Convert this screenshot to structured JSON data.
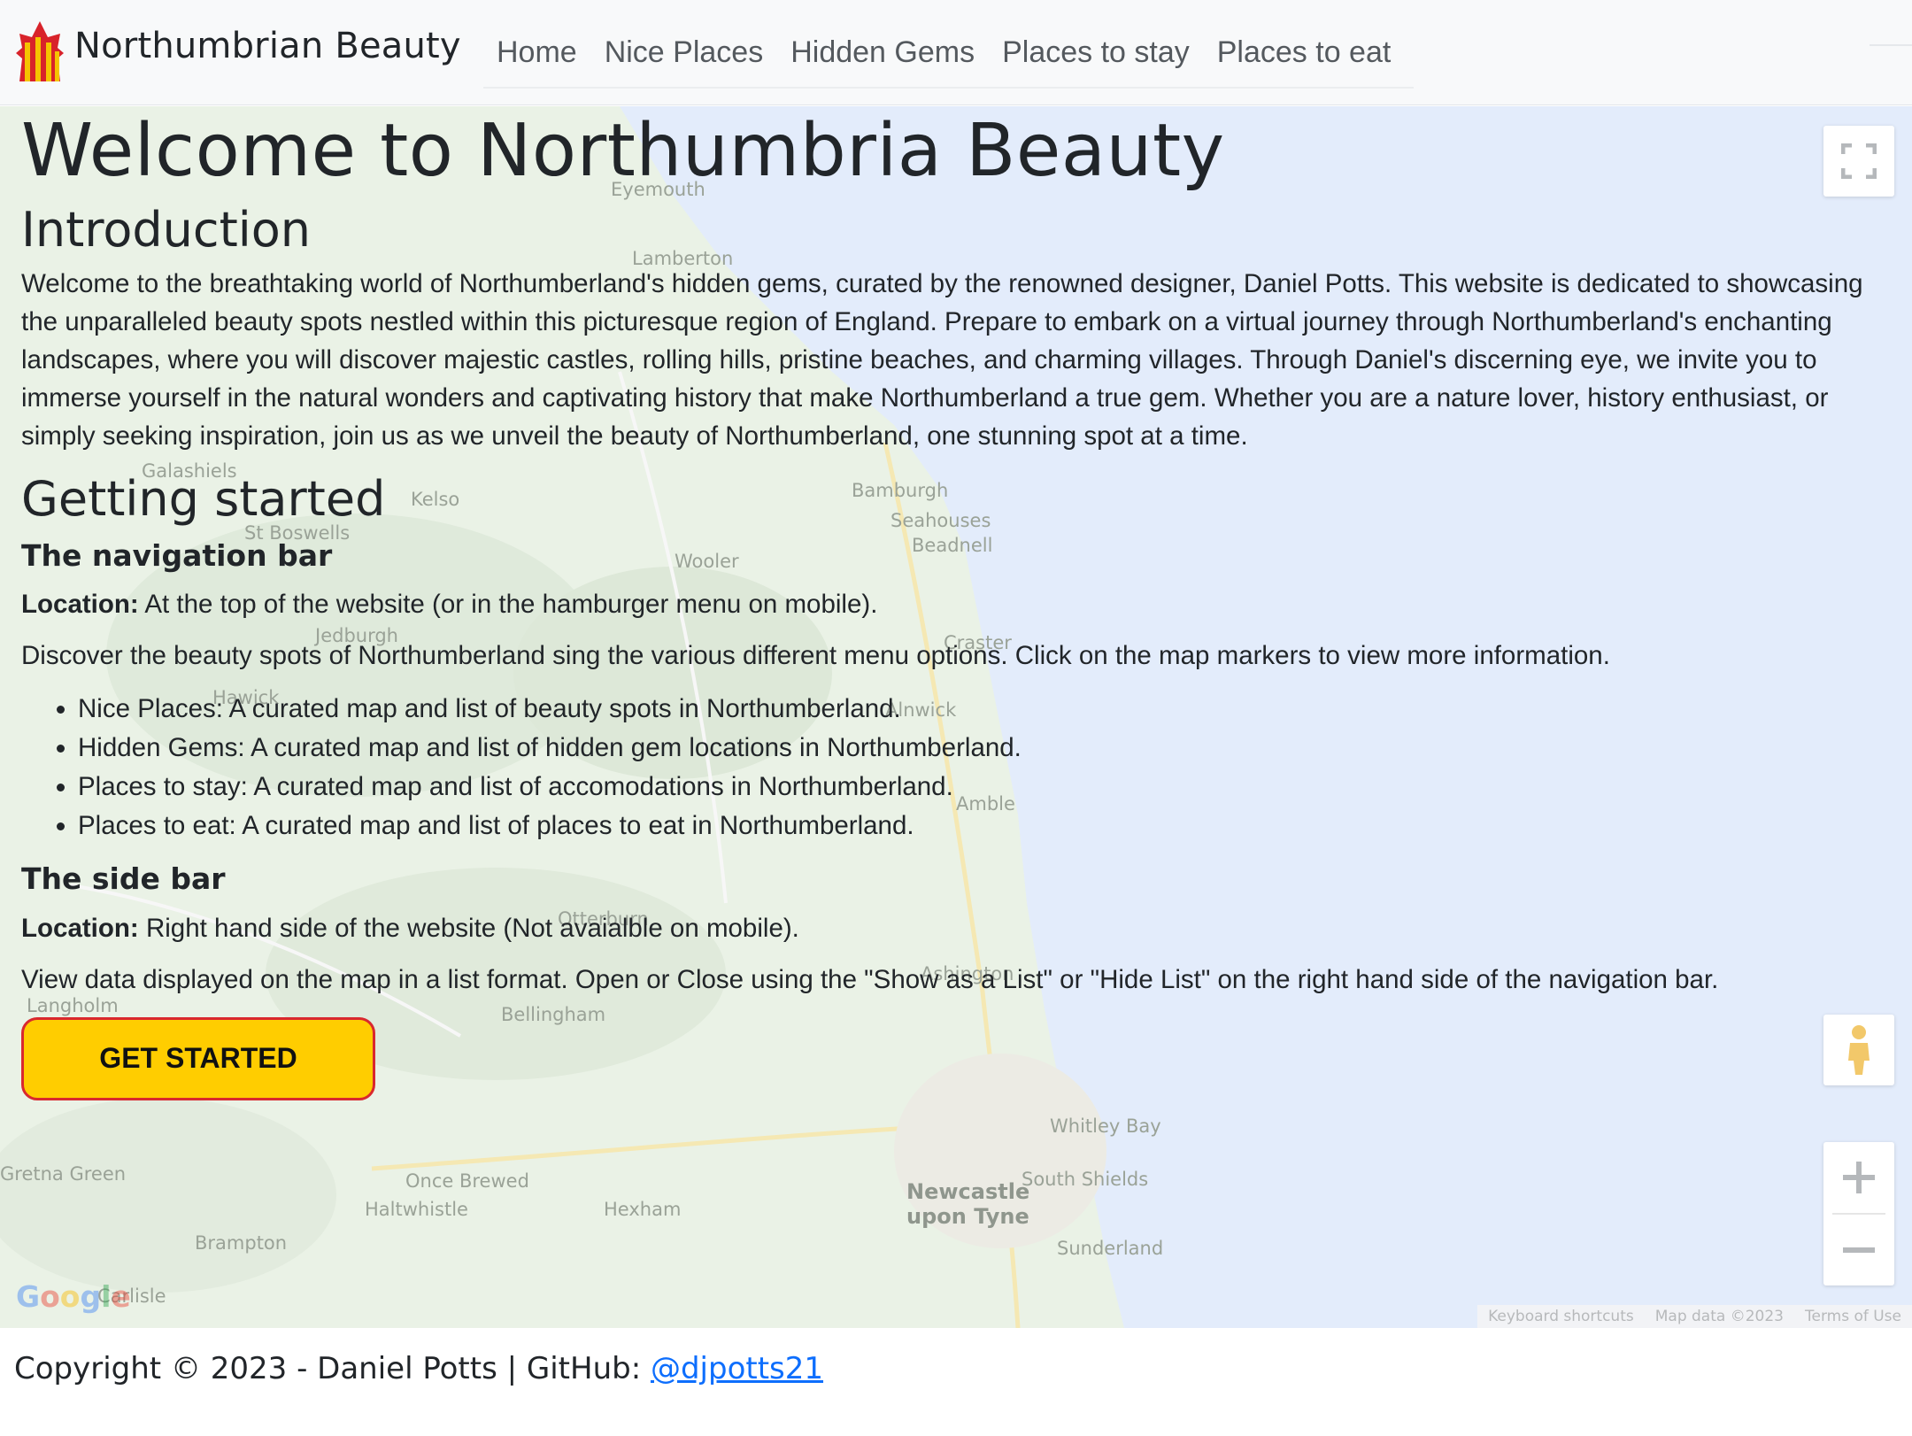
{
  "brand": {
    "name": "Northumbrian Beauty",
    "logo_icon": "northumberland-flag-icon"
  },
  "nav": {
    "items": [
      {
        "label": "Home"
      },
      {
        "label": "Nice Places"
      },
      {
        "label": "Hidden Gems"
      },
      {
        "label": "Places to stay"
      },
      {
        "label": "Places to eat"
      }
    ]
  },
  "main": {
    "title": "Welcome to Northumbria Beauty",
    "intro_heading": "Introduction",
    "intro_text": "Welcome to the breathtaking world of Northumberland's hidden gems, curated by the renowned designer, Daniel Potts. This website is dedicated to showcasing the unparalleled beauty spots nestled within this picturesque region of England. Prepare to embark on a virtual journey through Northumberland's enchanting landscapes, where you will discover majestic castles, rolling hills, pristine beaches, and charming villages. Through Daniel's discerning eye, we invite you to immerse yourself in the natural wonders and captivating history that make Northumberland a true gem. Whether you are a nature lover, history enthusiast, or simply seeking inspiration, join us as we unveil the beauty of Northumberland, one stunning spot at a time.",
    "start_heading": "Getting started",
    "navbar_section": {
      "heading": "The navigation bar",
      "location_label": "Location:",
      "location_text": " At the top of the website (or in the hamburger menu on mobile).",
      "description": "Discover the beauty spots of Northumberland sing the various different menu options. Click on the map markers to view more information.",
      "items": [
        "Nice Places: A curated map and list of beauty spots in Northumberland.",
        "Hidden Gems: A curated map and list of hidden gem locations in Northumberland.",
        "Places to stay: A curated map and list of accomodations in Northumberland.",
        "Places to eat: A curated map and list of places to eat in Northumberland."
      ]
    },
    "sidebar_section": {
      "heading": "The side bar",
      "location_label": "Location:",
      "location_text": " Right hand side of the website (Not avaialble on mobile).",
      "description": "View data displayed on the map in a list format. Open or Close using the \"Show as a List\" or \"Hide List\" on the right hand side of the navigation bar."
    },
    "cta_label": "GET STARTED"
  },
  "map": {
    "labels": [
      "Eyemouth",
      "Lamberton",
      "Galashiels",
      "Kelso",
      "St Boswells",
      "Bamburgh",
      "Seahouses",
      "Beadnell",
      "Wooler",
      "Jedburgh",
      "Craster",
      "Alnwick",
      "Hawick",
      "Amble",
      "Otterburn",
      "Ashington",
      "Bellingham",
      "Whitley Bay",
      "South Shields",
      "Newcastle upon Tyne",
      "Sunderland",
      "Once Brewed",
      "Haltwhistle",
      "Hexham",
      "Brampton",
      "Gretna Green",
      "Langholm",
      "Carlisle"
    ],
    "google_logo": "Google",
    "footer": [
      "Keyboard shortcuts",
      "Map data ©2023",
      "Terms of Use"
    ],
    "fullscreen_icon": "fullscreen-icon",
    "pegman_icon": "pegman-icon",
    "zoom_in_icon": "zoom-in-icon",
    "zoom_out_icon": "zoom-out-icon",
    "sea_color": "#e3ecfb",
    "land_color": "#eaf2e6"
  },
  "footer": {
    "text": "Copyright © 2023 - Daniel Potts | GitHub: ",
    "link_text": "@djpotts21"
  },
  "colors": {
    "button_fill": "#ffcd00",
    "button_border": "#d9282e",
    "link": "#0d6efd"
  }
}
